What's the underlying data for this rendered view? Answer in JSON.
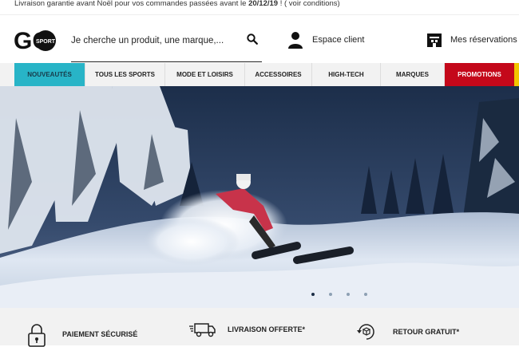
{
  "topbar": {
    "text_before": "Livraison garantie avant Noël pour vos commandes passées avant le ",
    "date": "20/12/19",
    "text_after": " ! ( voir conditions)"
  },
  "header": {
    "logo": {
      "text_main": "GO",
      "text_sub": "SPORT"
    },
    "search": {
      "placeholder": "Je cherche un produit, une marque,..."
    },
    "account_label": "Espace client",
    "reservations_label": "Mes réservations"
  },
  "nav": {
    "items": [
      {
        "label": "NOUVEAUTÉS",
        "state": "active"
      },
      {
        "label": "TOUS LES SPORTS"
      },
      {
        "label": "MODE ET LOISIRS"
      },
      {
        "label": "ACCESSOIRES"
      },
      {
        "label": "HIGH-TECH"
      },
      {
        "label": "MARQUES"
      },
      {
        "label": "PROMOTIONS",
        "state": "promo"
      }
    ]
  },
  "hero": {
    "slides_count": 4,
    "active_slide": 1
  },
  "features": [
    {
      "label": "PAIEMENT SÉCURISÉ",
      "icon": "padlock-icon"
    },
    {
      "label": "LIVRAISON OFFERTE*",
      "icon": "delivery-truck-icon"
    },
    {
      "label": "RETOUR GRATUIT*",
      "icon": "return-box-icon"
    }
  ],
  "colors": {
    "accent": "#28b4c7",
    "promo": "#c4081a",
    "yellow": "#f2c500"
  }
}
